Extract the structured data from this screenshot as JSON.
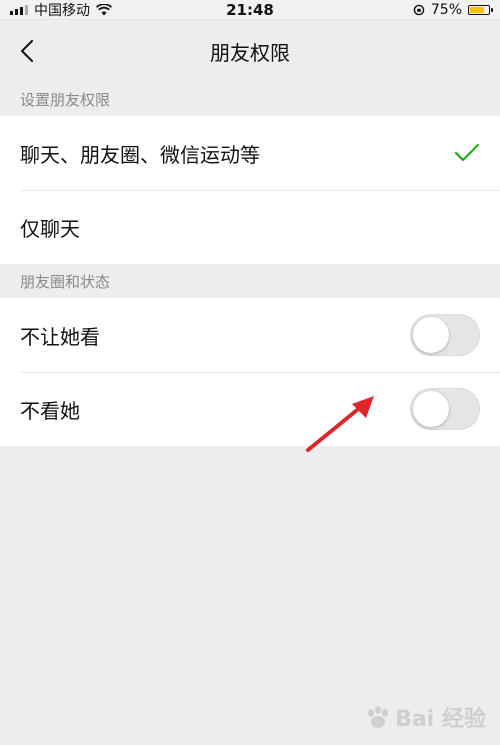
{
  "status_bar": {
    "carrier": "中国移动",
    "time": "21:48",
    "battery": "75%"
  },
  "nav": {
    "title": "朋友权限"
  },
  "sections": [
    {
      "header": "设置朋友权限",
      "items": [
        {
          "label": "聊天、朋友圈、微信运动等",
          "selected": true
        },
        {
          "label": "仅聊天",
          "selected": false
        }
      ]
    },
    {
      "header": "朋友圈和状态",
      "items": [
        {
          "label": "不让她看",
          "toggle": false
        },
        {
          "label": "不看她",
          "toggle": false
        }
      ]
    }
  ],
  "colors": {
    "check": "#1aad19",
    "arrow": "#e0262b",
    "background": "#ededed"
  },
  "watermark": {
    "text": "Bai 经验",
    "icon": "baidu-paw-icon"
  }
}
